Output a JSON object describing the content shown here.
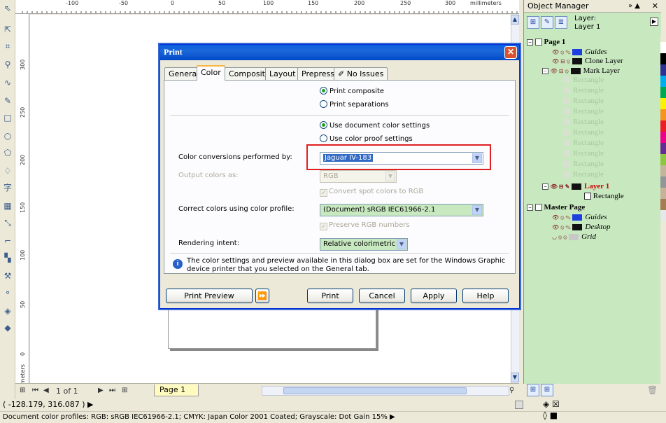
{
  "ruler": {
    "h_ticks": [
      "-100",
      "-50",
      "0",
      "50",
      "100",
      "150",
      "200",
      "250",
      "300"
    ],
    "h_units": "millimeters",
    "v_ticks": [
      "300",
      "250",
      "200",
      "150",
      "100",
      "50",
      "0"
    ],
    "v_units": "millimeters"
  },
  "pagebar": {
    "page_count": "1 of 1",
    "page_tab": "Page 1"
  },
  "status": {
    "coords": "( -128.179, 316.087 )",
    "profiles": "Document color profiles: RGB: sRGB IEC61966-2.1; CMYK: Japan Color 2001 Coated; Grayscale: Dot Gain 15%"
  },
  "object_manager": {
    "title": "Object Manager",
    "layer_label": "Layer:",
    "layer_name": "Layer 1",
    "page1": "Page 1",
    "guides": "Guides",
    "clone_layer": "Clone Layer",
    "mark_layer": "Mark Layer",
    "rect_items": [
      "Rectangle",
      "Rectangle",
      "Rectangle",
      "Rectangle",
      "Rectangle",
      "Rectangle",
      "Rectangle",
      "Rectangle",
      "Rectangle",
      "Rectangle"
    ],
    "layer1": "Layer 1",
    "rectangle": "Rectangle",
    "master_page": "Master Page",
    "master_guides": "Guides",
    "desktop": "Desktop",
    "grid": "Grid"
  },
  "dialog": {
    "title": "Print",
    "tabs": [
      "General",
      "Color",
      "Composite",
      "Layout",
      "Prepress",
      "No Issues"
    ],
    "print_composite": "Print composite",
    "print_separations": "Print separations",
    "use_document": "Use document color settings",
    "use_proof": "Use color proof settings",
    "conversions_label": "Color conversions performed by:",
    "conversions_value": "Jaguar IV-183",
    "output_label": "Output colors as:",
    "output_value": "RGB",
    "convert_spot": "Convert spot colors to RGB",
    "correct_label": "Correct colors using color profile:",
    "correct_value": "(Document) sRGB IEC61966-2.1",
    "preserve_rgb": "Preserve RGB numbers",
    "rendering_label": "Rendering intent:",
    "rendering_value": "Relative colorimetric",
    "info": "The color settings and preview available in this dialog box are set for the Windows Graphic device printer that you selected on the General tab.",
    "btn_preview": "Print Preview",
    "btn_print": "Print",
    "btn_cancel": "Cancel",
    "btn_apply": "Apply",
    "btn_help": "Help"
  },
  "colors": {
    "palette": [
      "#ffffff",
      "#000000",
      "#2e3192",
      "#00aeef",
      "#00a651",
      "#fff200",
      "#f7941d",
      "#ed1c24",
      "#ec008c",
      "#662d91",
      "#8dc63f",
      "#c2b59b",
      "#939598",
      "#c7b299",
      "#a67c52",
      "#e6e7e8"
    ],
    "accent": "#0a5fde",
    "highlight_box": "#e02020"
  }
}
